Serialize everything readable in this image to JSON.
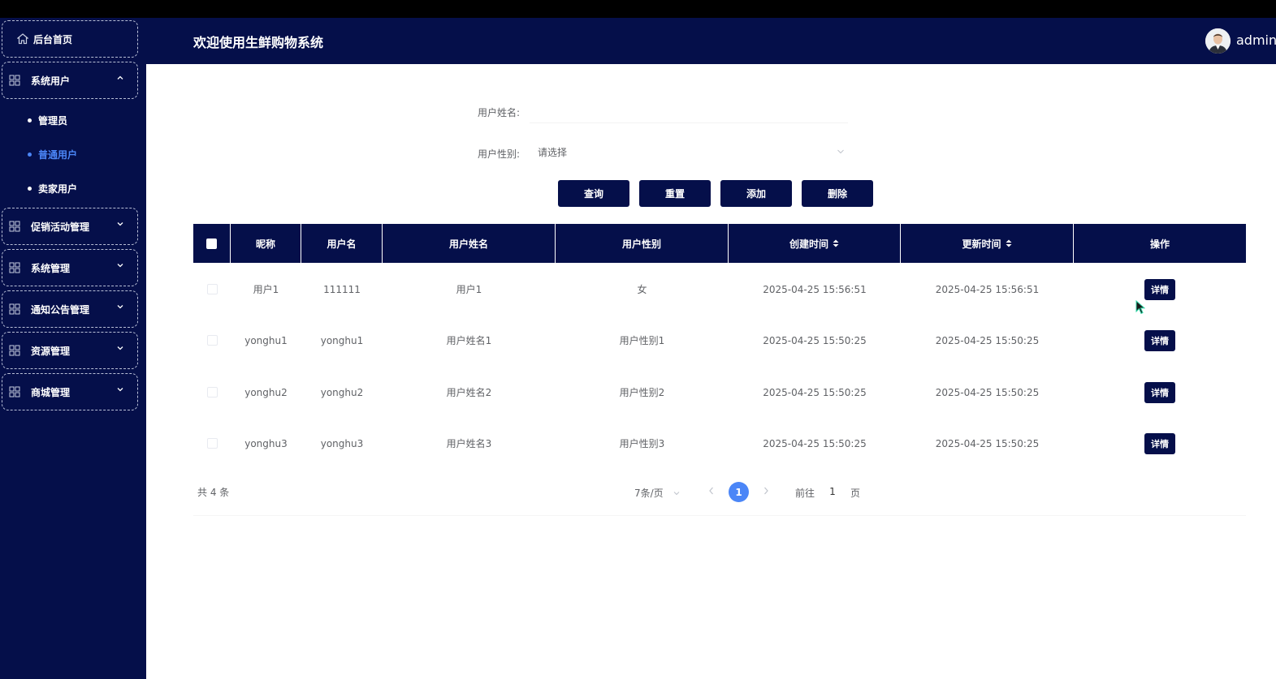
{
  "header": {
    "title": "欢迎使用生鲜购物系统",
    "username": "admin"
  },
  "sidebar": {
    "home": "后台首页",
    "groups": [
      {
        "label": "系统用户"
      },
      {
        "label": "促销活动管理"
      },
      {
        "label": "系统管理"
      },
      {
        "label": "通知公告管理"
      },
      {
        "label": "资源管理"
      },
      {
        "label": "商城管理"
      }
    ],
    "sub_items": [
      {
        "label": "管理员"
      },
      {
        "label": "普通用户"
      },
      {
        "label": "卖家用户"
      }
    ]
  },
  "search": {
    "name_label": "用户姓名:",
    "name_value": "",
    "gender_label": "用户性别:",
    "gender_placeholder": "请选择"
  },
  "buttons": {
    "query": "查询",
    "reset": "重置",
    "add": "添加",
    "delete": "删除"
  },
  "table": {
    "columns": [
      "昵称",
      "用户名",
      "用户姓名",
      "用户性别",
      "创建时间",
      "更新时间",
      "操作"
    ],
    "rows": [
      {
        "nickname": "用户1",
        "username": "111111",
        "realname": "用户1",
        "gender": "女",
        "created": "2025-04-25 15:56:51",
        "updated": "2025-04-25 15:56:51",
        "action": "详情"
      },
      {
        "nickname": "yonghu1",
        "username": "yonghu1",
        "realname": "用户姓名1",
        "gender": "用户性别1",
        "created": "2025-04-25 15:50:25",
        "updated": "2025-04-25 15:50:25",
        "action": "详情"
      },
      {
        "nickname": "yonghu2",
        "username": "yonghu2",
        "realname": "用户姓名2",
        "gender": "用户性别2",
        "created": "2025-04-25 15:50:25",
        "updated": "2025-04-25 15:50:25",
        "action": "详情"
      },
      {
        "nickname": "yonghu3",
        "username": "yonghu3",
        "realname": "用户姓名3",
        "gender": "用户性别3",
        "created": "2025-04-25 15:50:25",
        "updated": "2025-04-25 15:50:25",
        "action": "详情"
      }
    ]
  },
  "pagination": {
    "total": "共 4 条",
    "page_size": "7条/页",
    "current_page": "1",
    "goto_prefix": "前往",
    "goto_value": "1",
    "goto_suffix": "页"
  },
  "colors": {
    "navy": "#050f4a",
    "accent_blue": "#4b86f7"
  }
}
